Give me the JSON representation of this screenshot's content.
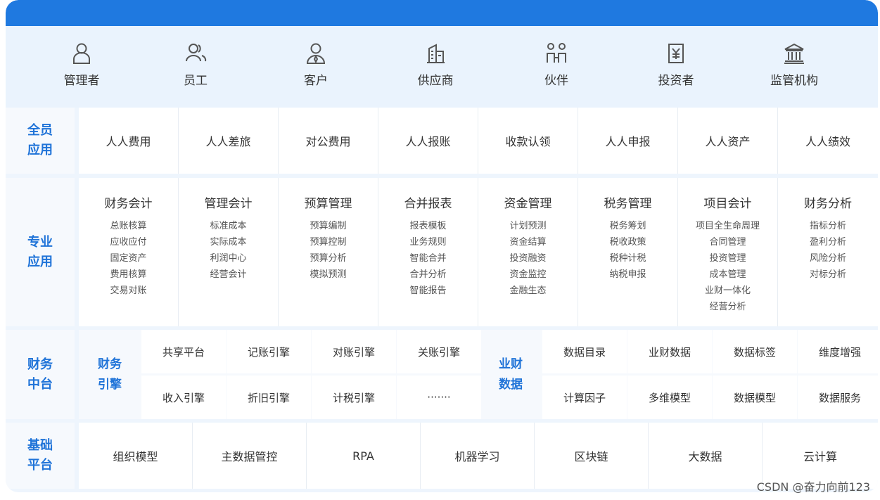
{
  "roles": [
    "管理者",
    "员工",
    "客户",
    "供应商",
    "伙伴",
    "投资者",
    "监管机构"
  ],
  "rows": {
    "all_staff": {
      "label_line1": "全员",
      "label_line2": "应用",
      "items": [
        "人人费用",
        "人人差旅",
        "对公费用",
        "人人报账",
        "收款认领",
        "人人申报",
        "人人资产",
        "人人绩效"
      ]
    },
    "professional": {
      "label_line1": "专业",
      "label_line2": "应用",
      "columns": [
        {
          "title": "财务会计",
          "items": [
            "总账核算",
            "应收应付",
            "固定资产",
            "费用核算",
            "交易对账"
          ]
        },
        {
          "title": "管理会计",
          "items": [
            "标准成本",
            "实际成本",
            "利润中心",
            "经营会计"
          ]
        },
        {
          "title": "预算管理",
          "items": [
            "预算编制",
            "预算控制",
            "预算分析",
            "模拟预测"
          ]
        },
        {
          "title": "合并报表",
          "items": [
            "报表模板",
            "业务规则",
            "智能合并",
            "合并分析",
            "智能报告"
          ]
        },
        {
          "title": "资金管理",
          "items": [
            "计划预测",
            "资金结算",
            "投资融资",
            "资金监控",
            "金融生态"
          ]
        },
        {
          "title": "税务管理",
          "items": [
            "税务筹划",
            "税收政策",
            "税种计税",
            "纳税申报"
          ]
        },
        {
          "title": "项目会计",
          "items": [
            "项目全生命周理",
            "合同管理",
            "投资管理",
            "成本管理",
            "业财一体化",
            "经营分析"
          ]
        },
        {
          "title": "财务分析",
          "items": [
            "指标分析",
            "盈利分析",
            "风险分析",
            "对标分析"
          ]
        }
      ]
    },
    "middle": {
      "label_line1": "财务",
      "label_line2": "中台",
      "engine_head_line1": "财务",
      "engine_head_line2": "引擎",
      "engine_items": [
        "共享平台",
        "记账引擎",
        "对账引擎",
        "关账引擎",
        "收入引擎",
        "折旧引擎",
        "计税引擎",
        "·······"
      ],
      "data_head_line1": "业财",
      "data_head_line2": "数据",
      "data_items": [
        "数据目录",
        "业财数据",
        "数据标签",
        "维度增强",
        "计算因子",
        "多维模型",
        "数据模型",
        "数据服务"
      ]
    },
    "base": {
      "label_line1": "基础",
      "label_line2": "平台",
      "items": [
        "组织模型",
        "主数据管控",
        "RPA",
        "机器学习",
        "区块链",
        "大数据",
        "云计算"
      ]
    }
  },
  "watermark": "CSDN @奋力向前123",
  "colors": {
    "accent": "#1f79e0",
    "label_text": "#1f73d8",
    "background": "#eef5fd"
  },
  "icons": [
    "person-icon",
    "people-icon",
    "customer-icon",
    "building-icon",
    "partners-icon",
    "investor-icon",
    "institution-icon"
  ]
}
